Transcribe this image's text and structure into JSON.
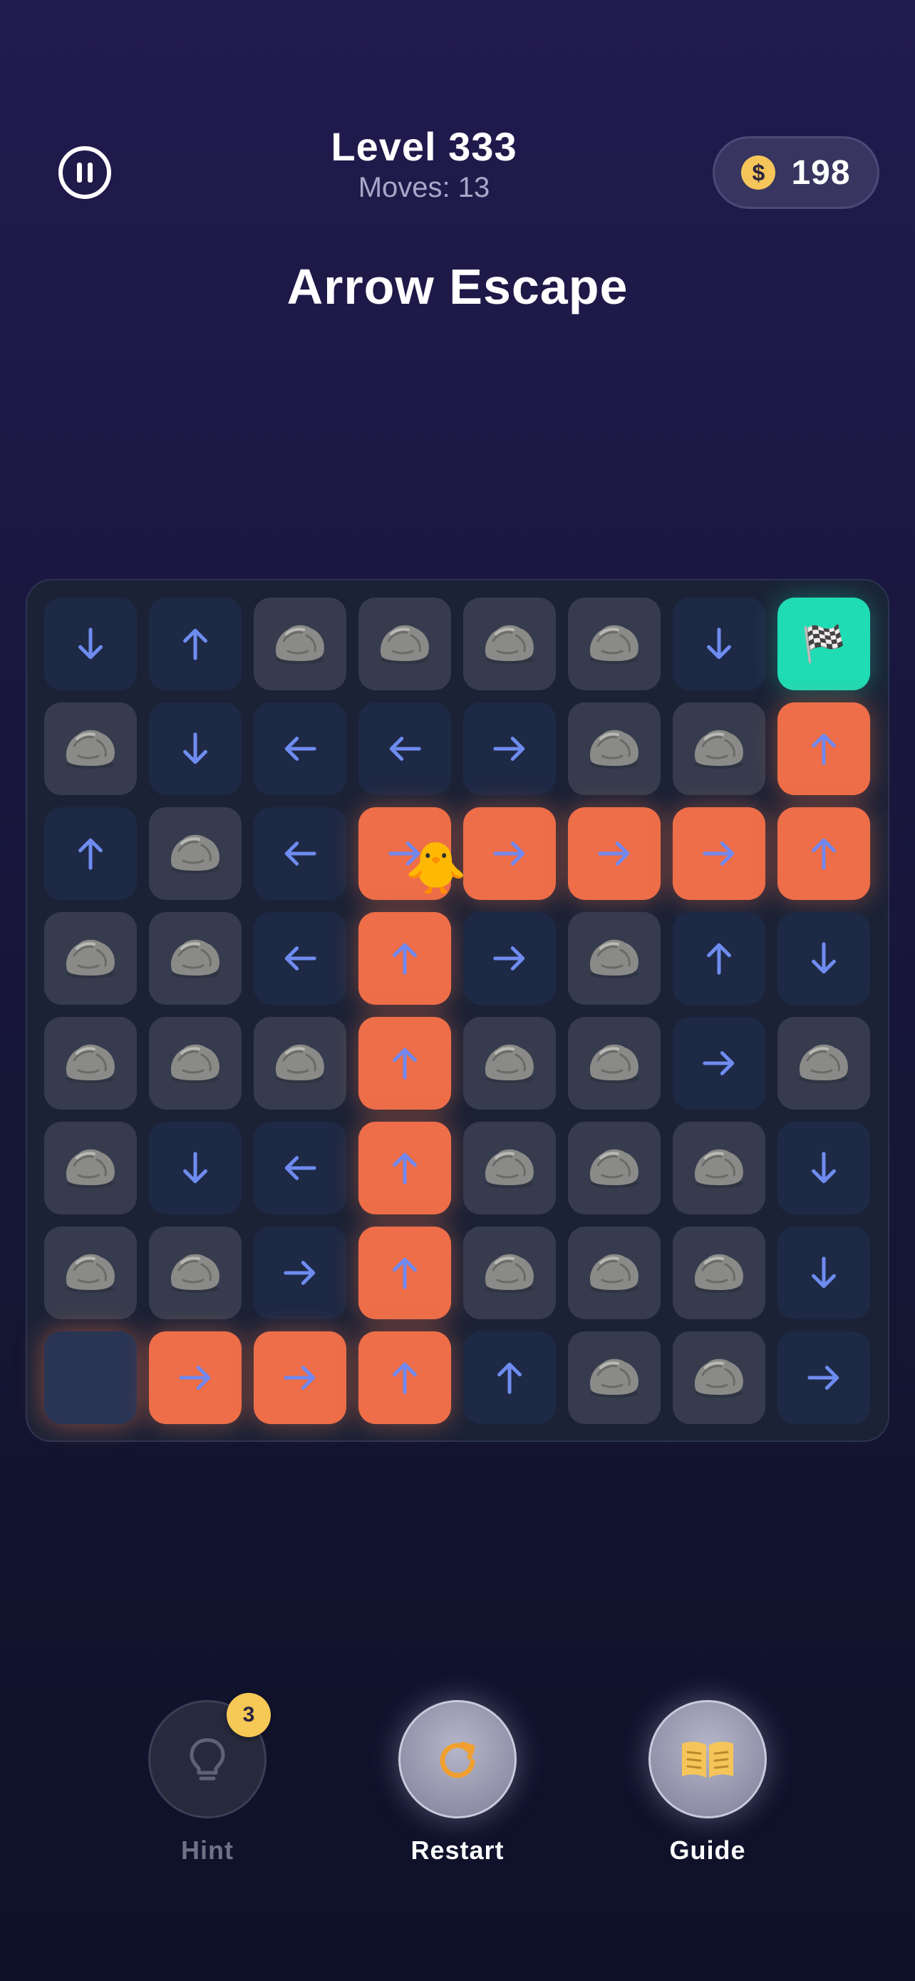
{
  "header": {
    "level": "Level 333",
    "moves": "Moves: 13",
    "coins": "198",
    "coin_symbol": "$",
    "title": "Arrow Escape"
  },
  "board": {
    "rows": 8,
    "cols": 8,
    "cells": [
      [
        "down",
        "up",
        "rock",
        "rock",
        "rock",
        "rock",
        "down",
        "goal"
      ],
      [
        "rock",
        "down",
        "left",
        "left",
        "right",
        "rock",
        "rock",
        "path-up"
      ],
      [
        "up",
        "rock",
        "left",
        "path-right",
        "path-right",
        "path-right",
        "path-right",
        "path-up"
      ],
      [
        "rock",
        "rock",
        "left",
        "path-up",
        "right",
        "rock",
        "up",
        "down"
      ],
      [
        "rock",
        "rock",
        "rock",
        "path-up",
        "rock",
        "rock",
        "right",
        "rock"
      ],
      [
        "rock",
        "down",
        "left",
        "path-up",
        "rock",
        "rock",
        "rock",
        "down"
      ],
      [
        "rock",
        "rock",
        "right",
        "path-up",
        "rock",
        "rock",
        "rock",
        "down"
      ],
      [
        "start",
        "path-right",
        "path-right",
        "path-up",
        "up",
        "rock",
        "rock",
        "right"
      ]
    ],
    "player": "🐥",
    "player_position": {
      "row": 2,
      "col": 3
    },
    "goal_icon": "🏁"
  },
  "actions": [
    {
      "name": "hint",
      "label": "Hint",
      "icon": "lightbulb-icon",
      "badge": "3",
      "enabled": false
    },
    {
      "name": "restart",
      "label": "Restart",
      "icon": "restart-icon",
      "enabled": true
    },
    {
      "name": "guide",
      "label": "Guide",
      "icon": "book-icon",
      "enabled": true
    }
  ],
  "colors": {
    "path": "#ED6E48",
    "goal": "#1FDCB4",
    "arrow": "#6E8CF0",
    "coin": "#F5C55A",
    "badge": "#F6C856",
    "accent_orange": "#F0A030"
  }
}
